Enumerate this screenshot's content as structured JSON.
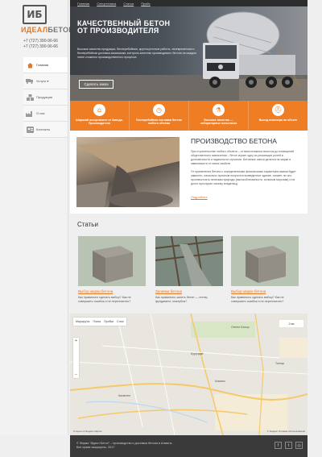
{
  "brand": {
    "logo_mark": "ИБ",
    "name_a": "ИДЕАЛ",
    "name_b": "БЕТОН",
    "phone1": "+7 (727) 390-96-66",
    "phone2": "+7 (727) 390-96-66"
  },
  "nav": {
    "items": [
      {
        "label": "Главная",
        "icon": "home-icon"
      },
      {
        "label": "Услуги ▾",
        "icon": "truck-icon"
      },
      {
        "label": "Продукция",
        "icon": "blocks-icon"
      },
      {
        "label": "О нас",
        "icon": "factory-icon"
      },
      {
        "label": "Контакты",
        "icon": "contacts-icon"
      }
    ]
  },
  "topbar": {
    "links": [
      "Главная",
      "Спецтехника",
      "Статьи",
      "Прайс"
    ]
  },
  "hero": {
    "title_line1": "КАЧЕСТВЕННЫЙ БЕТОН",
    "title_line2": "ОТ ПРОИЗВОДИТЕЛЯ",
    "description": "Высокое качество продукции, бесперебойные, круглосуточные работы, своевременная и бесперебойная доставка заказчикам, контроль качества производимого бетона на каждом этапе сложного производственного процесса",
    "cta": "Сделать заказ"
  },
  "features": [
    {
      "label": "Широкий ассортимент от Завода-Производителя",
      "icon": "factory-icon"
    },
    {
      "label": "Бесперебойная поставка бетона любого объёма",
      "icon": "clock-icon"
    },
    {
      "label": "Высокое качество — лабораторные испытания",
      "icon": "flask-icon"
    },
    {
      "label": "Выезд инженера на объект",
      "icon": "helmet-icon"
    }
  ],
  "about": {
    "title": "ПРОИЗВОДСТВО БЕТОНА",
    "p1": "При строительстве любого объекта – от многоэтажных высоток до помещений общественного назначения – бетон играет одну из решающих ролей в долговечности и надежности строения. Бетонные смеси делятся на марки в зависимости от своих свойств",
    "p2": "От применения бетона с определенными физическими характеристиками будет зависеть, насколько прочным получится возведенное здание, сможет ли оно противостоять натискам природы (высокой влажности, сильным морозам) и на долго прослужит своему владельцу",
    "more": "Подробнее"
  },
  "articles": {
    "title": "Статьи",
    "items": [
      {
        "title": "Выбор марки бетона",
        "desc": "Как правильно сделать выбор? Как не совершить ошибок и не переплатить?"
      },
      {
        "title": "Заливка бетона",
        "desc": "Как правильно залить бетон — стены, фундамент, опалубка?"
      },
      {
        "title": "Выбор марки бетона",
        "desc": "Как правильно сделать выбор? Как не совершить ошибок и не переплатить?"
      }
    ]
  },
  "map": {
    "toolbar": [
      "Маршруты",
      "Поиск",
      "Пробки",
      "Слои"
    ],
    "scale": "2 км",
    "labels": [
      "Алматы",
      "Каскелен",
      "Талгар",
      "Бурундай",
      "Отеген Батыр"
    ],
    "footer": "Открыть в Яндекс.Картах",
    "footer_right": "© Яндекс  Условия использования",
    "zoom_in": "+",
    "zoom_out": "−"
  },
  "footer": {
    "text": "© Фирма \"Идеал Бетон\" – производство и доставка бетона в Алматы. Все права защищены. 2017",
    "social": [
      "f",
      "t",
      "◎"
    ]
  }
}
